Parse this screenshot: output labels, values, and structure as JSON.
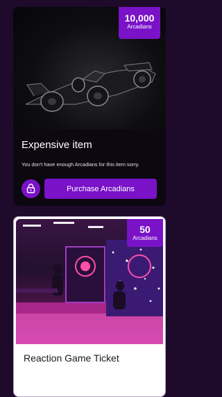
{
  "items": [
    {
      "title": "Expensive item",
      "price": "10,000",
      "currency": "Arcadians",
      "message": "You don't have enough Arcadians for this item sorry.",
      "purchase_label": "Purchase Arcadians"
    },
    {
      "title": "Reaction Game Ticket",
      "price": "50",
      "currency": "Arcadians"
    }
  ],
  "colors": {
    "background": "#1e0a2a",
    "accent": "#7a12c8",
    "card_dark": "#0c0810"
  }
}
